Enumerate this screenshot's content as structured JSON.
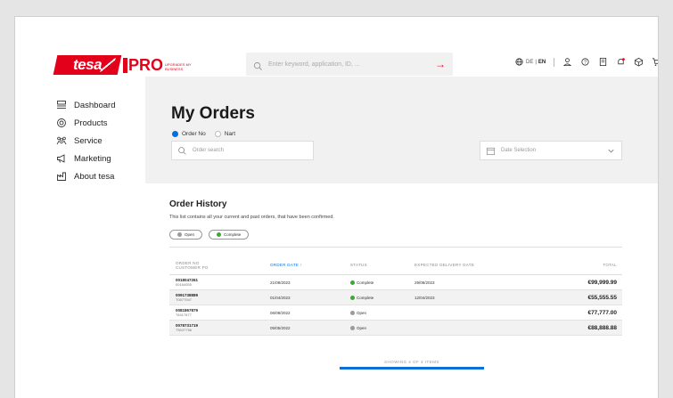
{
  "header": {
    "brand": "tesa",
    "pro_label": "PRO",
    "pro_tagline": "UPGRADES MY BUSINESS",
    "search_placeholder": "Enter keyword, application, ID, ...",
    "lang_de": "DE",
    "lang_en": "EN"
  },
  "sidebar": {
    "items": [
      {
        "label": "Dashboard",
        "icon": "dashboard-icon"
      },
      {
        "label": "Products",
        "icon": "products-icon"
      },
      {
        "label": "Service",
        "icon": "service-icon"
      },
      {
        "label": "Marketing",
        "icon": "marketing-icon"
      },
      {
        "label": "About tesa",
        "icon": "factory-icon"
      }
    ]
  },
  "orders": {
    "title": "My Orders",
    "radio_order_no": "Order No",
    "radio_nart": "Nart",
    "search_placeholder": "Order search",
    "date_placeholder": "Date Selection"
  },
  "history": {
    "title": "Order History",
    "description": "This list contains all your current and past orders, that have been confirmed.",
    "filter_open": "Open",
    "filter_complete": "Complete",
    "columns": {
      "order_no": "ORDER NO",
      "customer_po": "CUSTOMER PO",
      "order_date": "ORDER DATE ↑",
      "status": "STATUS",
      "expected": "EXPECTED DELIVERY DATE",
      "total": "TOTAL"
    },
    "rows": [
      {
        "order_no": "0018047261",
        "customer_po": "00164055",
        "order_date": "21/08/2023",
        "status": "Complete",
        "expected": "29/08/2023",
        "total": "€99,999.99"
      },
      {
        "order_no": "0091738889",
        "customer_po": "T0577547",
        "order_date": "01/04/2023",
        "status": "Complete",
        "expected": "12/04/2023",
        "total": "€55,555.55"
      },
      {
        "order_no": "0081867879",
        "customer_po": "78417677",
        "order_date": "06/08/2022",
        "status": "Open",
        "expected": "",
        "total": "€77,777.00"
      },
      {
        "order_no": "0078731719",
        "customer_po": "T5037756",
        "order_date": "05/05/2022",
        "status": "Open",
        "expected": "",
        "total": "€88,888.88"
      }
    ],
    "showing": "SHOWING 4 OF 4 ITEMS"
  },
  "colors": {
    "brand_red": "#e3001b",
    "accent_blue": "#0a6fd8",
    "complete_green": "#3aa935",
    "open_grey": "#9a9a9a"
  }
}
